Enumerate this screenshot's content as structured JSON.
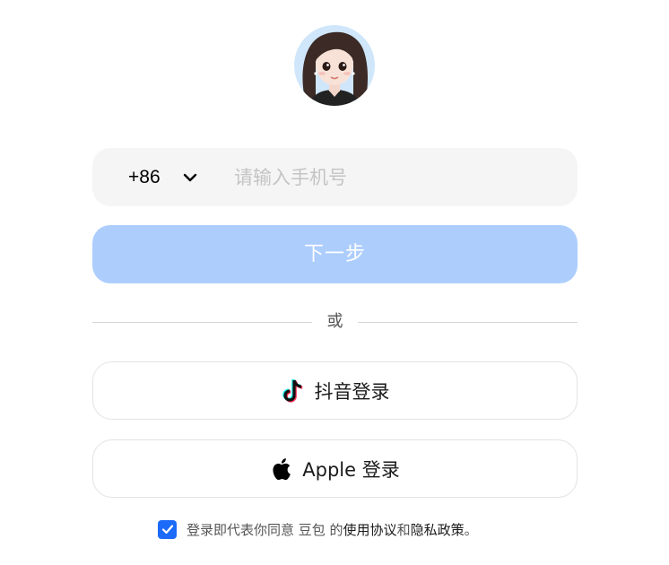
{
  "login": {
    "avatar_icon": "doubao-avatar",
    "country_code": "+86",
    "phone_placeholder": "请输入手机号",
    "phone_value": "",
    "next_label": "下一步",
    "divider_text": "或",
    "douyin_label": "抖音登录",
    "apple_label": "Apple 登录",
    "agreement": {
      "checked": true,
      "prefix": "登录即代表你同意 豆包 的 ",
      "terms": "使用协议",
      "and": " 和 ",
      "privacy": "隐私政策",
      "suffix": "。"
    }
  },
  "colors": {
    "primary_disabled": "#adcefd",
    "checkbox": "#1c6af8",
    "input_bg": "#f5f5f5"
  }
}
